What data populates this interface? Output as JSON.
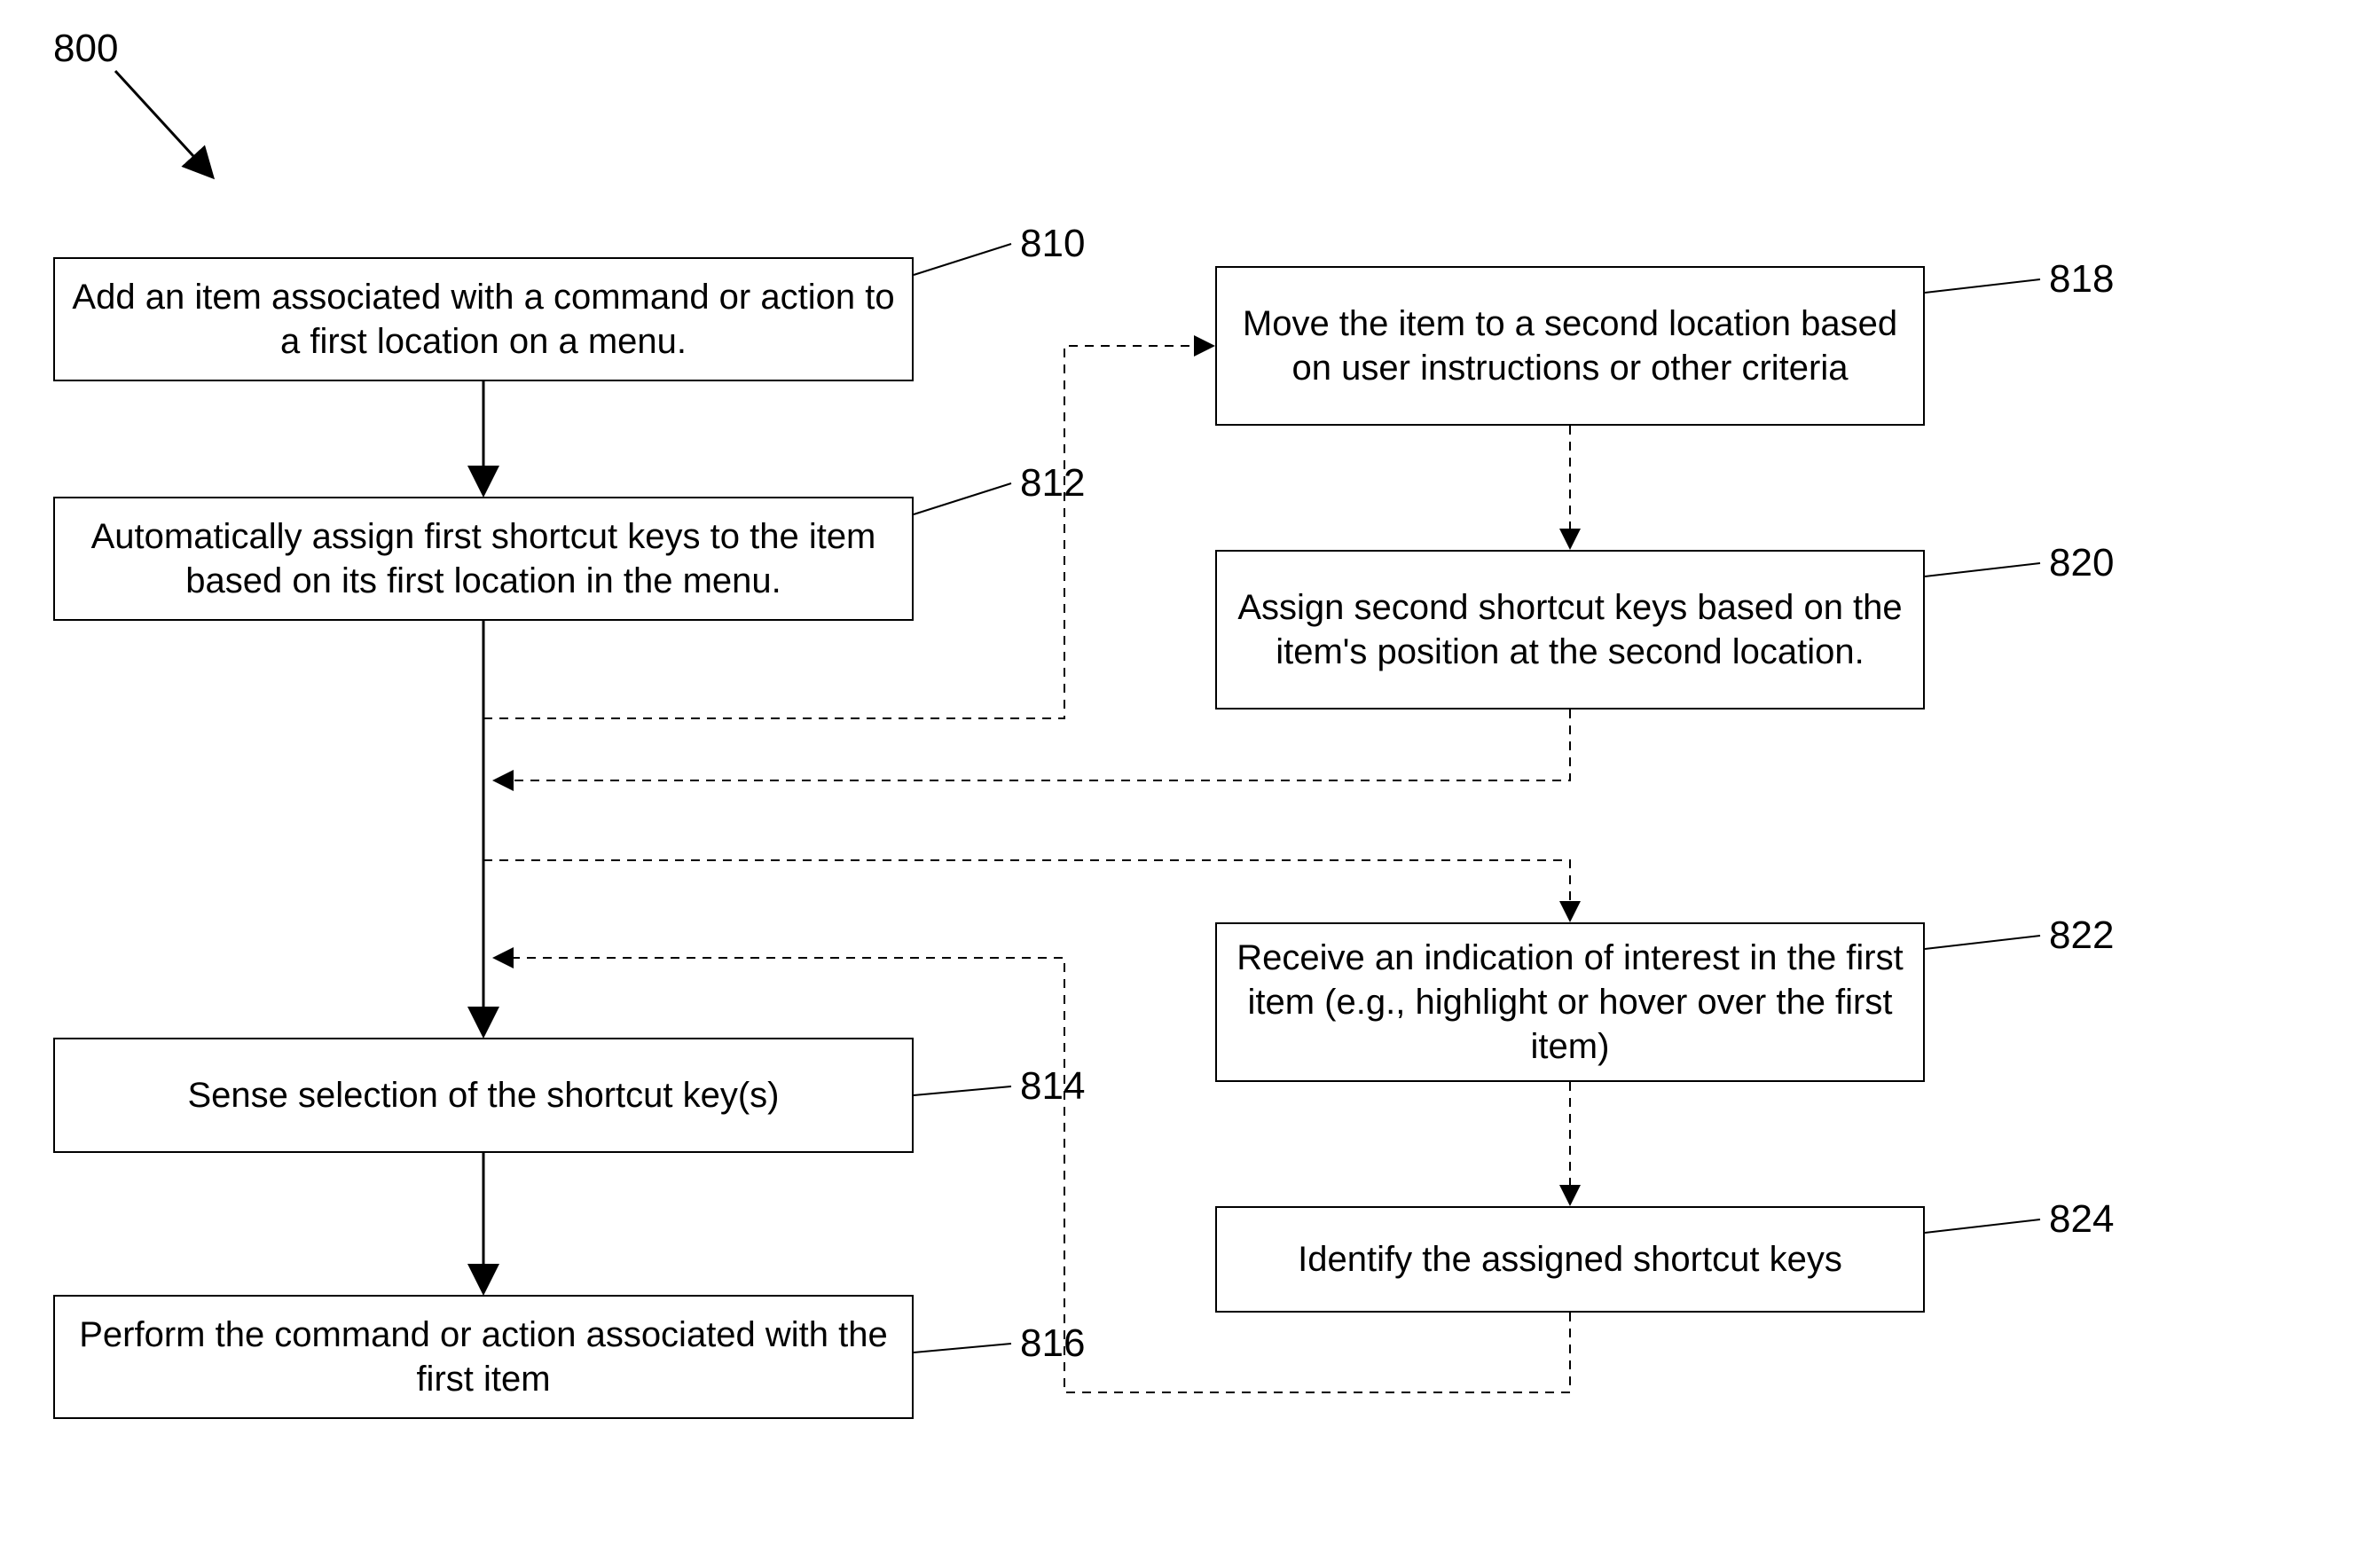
{
  "diagram_ref": "800",
  "boxes": {
    "b810": {
      "ref": "810",
      "text": "Add an item associated with a command or action to a first location on a menu."
    },
    "b812": {
      "ref": "812",
      "text": "Automatically assign first shortcut keys to the item based on its first location in the menu."
    },
    "b814": {
      "ref": "814",
      "text": "Sense selection of the shortcut key(s)"
    },
    "b816": {
      "ref": "816",
      "text": "Perform the command or action associated with the first item"
    },
    "b818": {
      "ref": "818",
      "text": "Move the item to a second location based on user instructions or other criteria"
    },
    "b820": {
      "ref": "820",
      "text": "Assign second shortcut keys based on the item's position at the second location."
    },
    "b822": {
      "ref": "822",
      "text": "Receive an indication of interest in the first item (e.g., highlight or hover over the first item)"
    },
    "b824": {
      "ref": "824",
      "text": "Identify the assigned shortcut keys"
    }
  }
}
